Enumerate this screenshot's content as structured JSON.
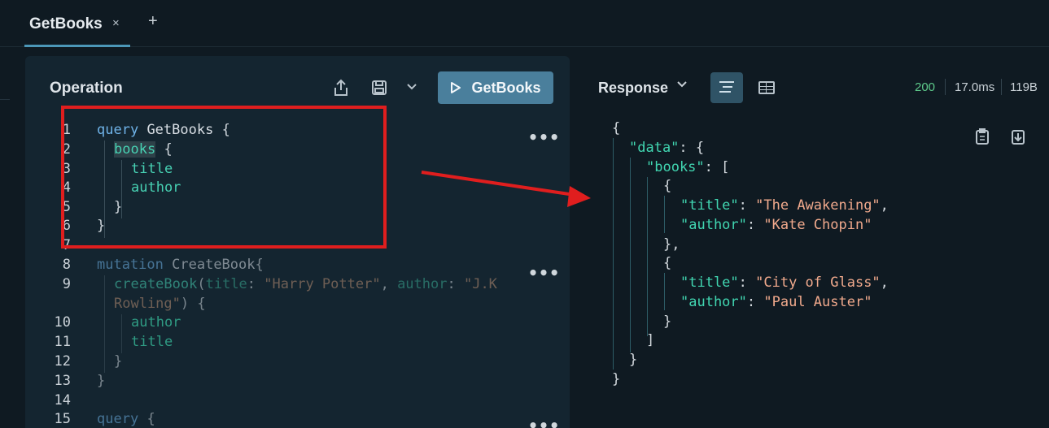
{
  "tab": {
    "label": "GetBooks",
    "close_glyph": "×",
    "add_glyph": "+"
  },
  "operation": {
    "title": "Operation",
    "run_label": "GetBooks",
    "icons": [
      "share-icon",
      "save-icon",
      "chevron-down-icon",
      "play-icon"
    ]
  },
  "code": {
    "line_numbers": [
      "1",
      "2",
      "3",
      "4",
      "5",
      "6",
      "7",
      "8",
      "9",
      "10",
      "11",
      "12",
      "13",
      "14",
      "15"
    ],
    "q1": {
      "kw": "query",
      "name": "GetBooks",
      "brace": "{"
    },
    "books": "books",
    "books_brace": "{",
    "title": "title",
    "author": "author",
    "close": "}",
    "m": {
      "kw": "mutation",
      "name": "CreateBook",
      "brace": "{"
    },
    "create": "createBook",
    "paren": "(",
    "arg_title": "title",
    "colon": ": ",
    "val_title": "\"Harry Potter\"",
    "comma": ", ",
    "arg_author": "author",
    "val_author_a": "\"J.K",
    "val_author_b": "Rowling\"",
    "paren_close": ") {",
    "q3": {
      "kw": "query",
      "brace": "{"
    },
    "menu_dots": "•••"
  },
  "response": {
    "title": "Response",
    "status": "200",
    "time": "17.0ms",
    "size": "119B",
    "json": {
      "open": "{",
      "data_key": "\"data\"",
      "books_key": "\"books\"",
      "colon_brace": ": {",
      "colon_bracket": ": [",
      "obj_open": "{",
      "title_key": "\"title\"",
      "author_key": "\"author\"",
      "colon": ": ",
      "comma": ",",
      "book1_title": "\"The Awakening\"",
      "book1_author": "\"Kate Chopin\"",
      "obj_close_comma": "},",
      "book2_title": "\"City of Glass\"",
      "book2_author": "\"Paul Auster\"",
      "obj_close": "}",
      "arr_close": "]",
      "close": "}"
    }
  }
}
